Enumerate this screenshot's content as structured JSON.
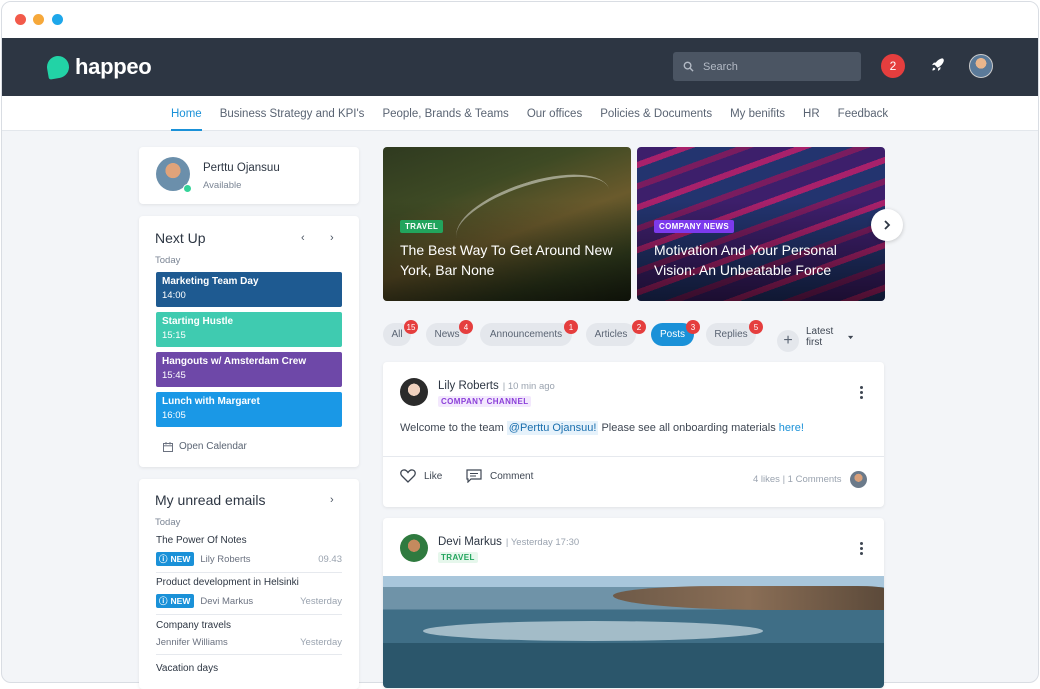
{
  "app": {
    "name": "happeo"
  },
  "search": {
    "placeholder": "Search"
  },
  "header": {
    "notifications": "2"
  },
  "nav": [
    "Home",
    "Business Strategy and KPI's",
    "People, Brands & Teams",
    "Our offices",
    "Policies & Documents",
    "My benifits",
    "HR",
    "Feedback"
  ],
  "profile": {
    "name": "Perttu Ojansuu",
    "status": "Available"
  },
  "next_up": {
    "title": "Next Up",
    "day": "Today",
    "events": [
      {
        "title": "Marketing Team Day",
        "time": "14:00",
        "color": "#1e5a91"
      },
      {
        "title": "Starting Hustle",
        "time": "15:15",
        "color": "#3fcbb0"
      },
      {
        "title": "Hangouts w/ Amsterdam Crew",
        "time": "15:45",
        "color": "#6e48a8"
      },
      {
        "title": "Lunch with Margaret",
        "time": "16:05",
        "color": "#1a98e6"
      }
    ],
    "open_calendar": "Open Calendar"
  },
  "emails": {
    "title": "My unread emails",
    "day": "Today",
    "badge": "NEW",
    "items": [
      {
        "subject": "The Power Of Notes",
        "from": "Lily Roberts",
        "time": "09.43"
      },
      {
        "subject": "Product development in Helsinki",
        "from": "Devi Markus",
        "time": "Yesterday"
      },
      {
        "subject": "Company travels",
        "from": "Jennifer Williams",
        "time": "Yesterday"
      },
      {
        "subject": "Vacation days"
      }
    ]
  },
  "tiles": [
    {
      "tag": "TRAVEL",
      "tag_color": "#22a45d",
      "title": "The Best Way To Get Around New York, Bar None"
    },
    {
      "tag": "COMPANY NEWS",
      "tag_color": "#7c3aed",
      "title": "Motivation And Your Personal Vision: An Unbeatable Force"
    }
  ],
  "filters": [
    {
      "label": "All",
      "count": "15"
    },
    {
      "label": "News",
      "count": "4"
    },
    {
      "label": "Announcements",
      "count": "1"
    },
    {
      "label": "Articles",
      "count": "2"
    },
    {
      "label": "Posts",
      "count": "3",
      "active": true
    },
    {
      "label": "Replies",
      "count": "5"
    }
  ],
  "sort": {
    "label": "Latest first"
  },
  "posts": [
    {
      "author": "Lily Roberts",
      "when": "| 10 min ago",
      "channel": "COMPANY CHANNEL",
      "text_before": "Welcome to the team ",
      "mention": "@Perttu Ojansuu!",
      "text_after": "  Please see all onboarding materials ",
      "link": "here!",
      "like": "Like",
      "comment": "Comment",
      "stats": "4 likes | 1 Comments"
    },
    {
      "author": "Devi Markus",
      "when": "| Yesterday 17:30",
      "channel": "TRAVEL"
    }
  ]
}
